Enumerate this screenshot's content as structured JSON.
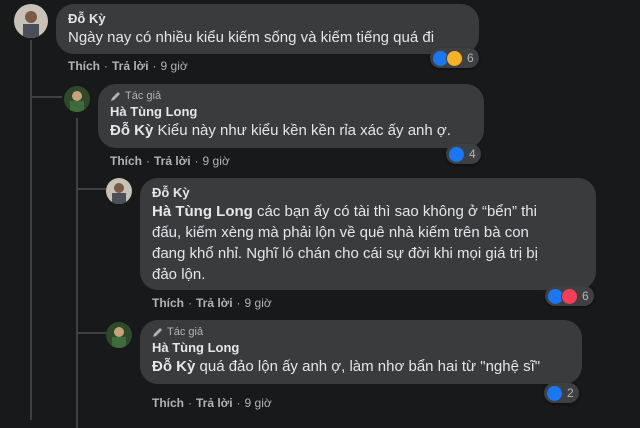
{
  "comments": [
    {
      "author": "Đỗ Kỳ",
      "text": "Ngày nay có nhiều kiểu kiếm sống và kiếm tiếng quá đi",
      "like_label": "Thích",
      "reply_label": "Trả lời",
      "time": "9 giờ",
      "reaction_count": "6",
      "reactions": [
        "like-icon",
        "sad-icon"
      ]
    },
    {
      "author_tag": "Tác giả",
      "author": "Hà Tùng Long",
      "mention": "Đỗ Kỳ",
      "text": "Kiểu này như kiểu kền kền rỉa xác ấy anh ợ.",
      "like_label": "Thích",
      "reply_label": "Trả lời",
      "time": "9 giờ",
      "reaction_count": "4",
      "reactions": [
        "like-icon"
      ]
    },
    {
      "author": "Đỗ Kỳ",
      "mention": "Hà Tùng Long",
      "text_line1": "các bạn ấy có tài thì sao không ở “bển” thi",
      "text_line2": "đấu, kiếm xèng mà phải lộn về quê nhà kiếm trên bà con",
      "text_line3": "đang khổ nhỉ. Nghĩ ló chán cho cái sự đời khi mọi giá trị bị",
      "text_line4": "đảo lộn.",
      "like_label": "Thích",
      "reply_label": "Trả lời",
      "time": "9 giờ",
      "reaction_count": "6",
      "reactions": [
        "like-icon",
        "love-icon"
      ]
    },
    {
      "author_tag": "Tác giả",
      "author": "Hà Tùng Long",
      "mention": "Đỗ Kỳ",
      "text": "quá đảo lộn ấy anh ợ, làm nhơ bẩn hai từ \"nghệ sĩ\"",
      "like_label": "Thích",
      "reply_label": "Trả lời",
      "time": "9 giờ",
      "reaction_count": "2",
      "reactions": [
        "like-icon"
      ]
    }
  ],
  "separator": "·",
  "colors": {
    "background": "#18191a",
    "bubble": "#3a3b3c",
    "text": "#e4e6eb",
    "muted": "#b0b3b8",
    "like": "#1877f2",
    "love": "#f33e58",
    "sad": "#f7b125"
  }
}
